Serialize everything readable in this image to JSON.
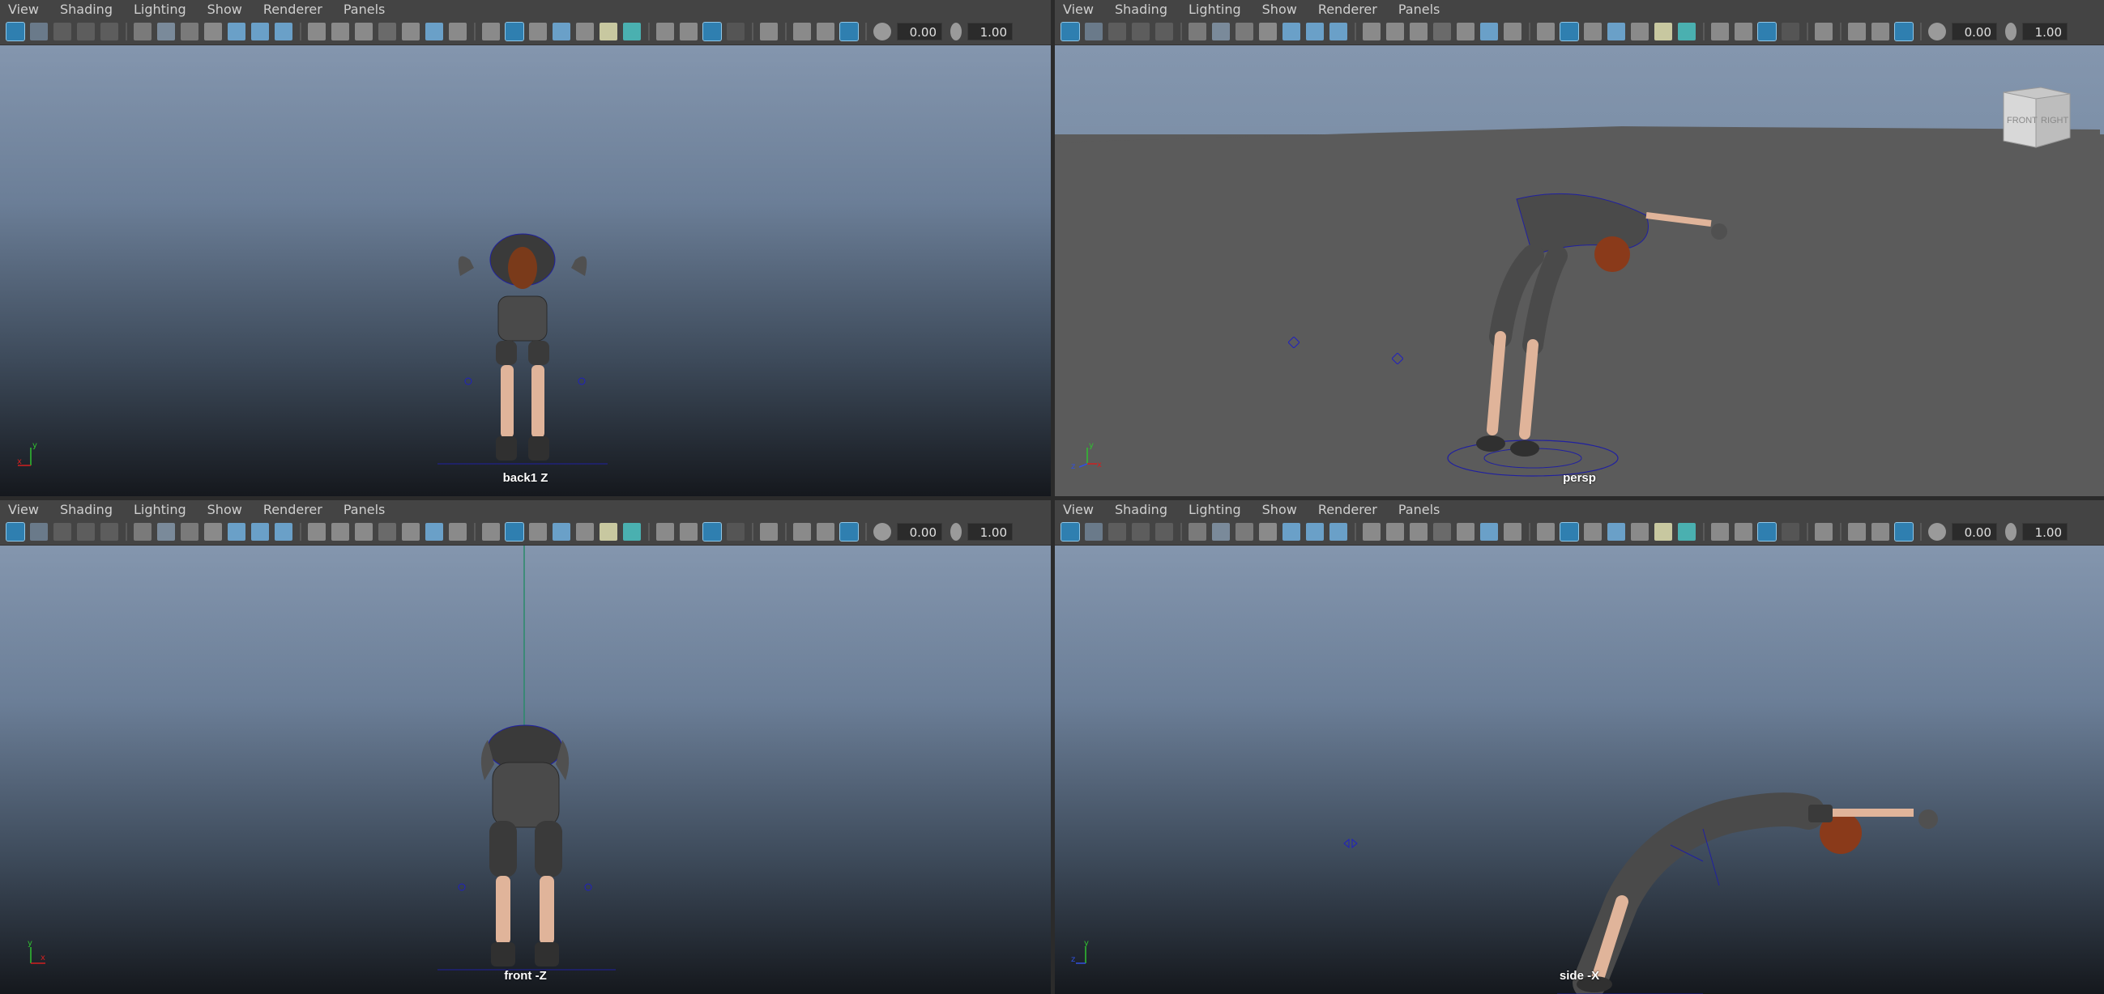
{
  "menu": {
    "view": "View",
    "shading": "Shading",
    "lighting": "Lighting",
    "show": "Show",
    "renderer": "Renderer",
    "panels": "Panels"
  },
  "toolbar": {
    "exposure": "0.00",
    "gamma": "1.00",
    "icons": [
      "camera-select-icon",
      "camera-attributes-icon",
      "bookmark-icon",
      "image-plane-icon",
      "grease-pencil-icon",
      "grid-icon",
      "film-gate-icon",
      "resolution-gate-icon",
      "safe-action-icon",
      "wireframe-icon",
      "smooth-shade-icon",
      "textured-icon",
      "lights-icon",
      "shadows-icon",
      "ambient-occlusion-icon",
      "isolate-select-icon",
      "xray-icon",
      "exposure-icon",
      "gamma-icon"
    ]
  },
  "viewports": {
    "top_left": {
      "label": "back1 Z",
      "axis_h": "x",
      "axis_v": "y"
    },
    "top_right": {
      "label": "persp",
      "axis_h": "x",
      "axis_v": "y",
      "axis_d": "z"
    },
    "bottom_left": {
      "label": "front -Z",
      "axis_h": "x",
      "axis_v": "y"
    },
    "bottom_right": {
      "label": "side -X",
      "axis_h": "z",
      "axis_v": "y"
    }
  },
  "view_cube": {
    "front": "FRONT",
    "right": "RIGHT"
  },
  "colors": {
    "accent": "#5aa0c8",
    "axis_x": "#d02020",
    "axis_y": "#30c030",
    "axis_z": "#3050e0",
    "ground_persp": "#5b5b5b"
  }
}
